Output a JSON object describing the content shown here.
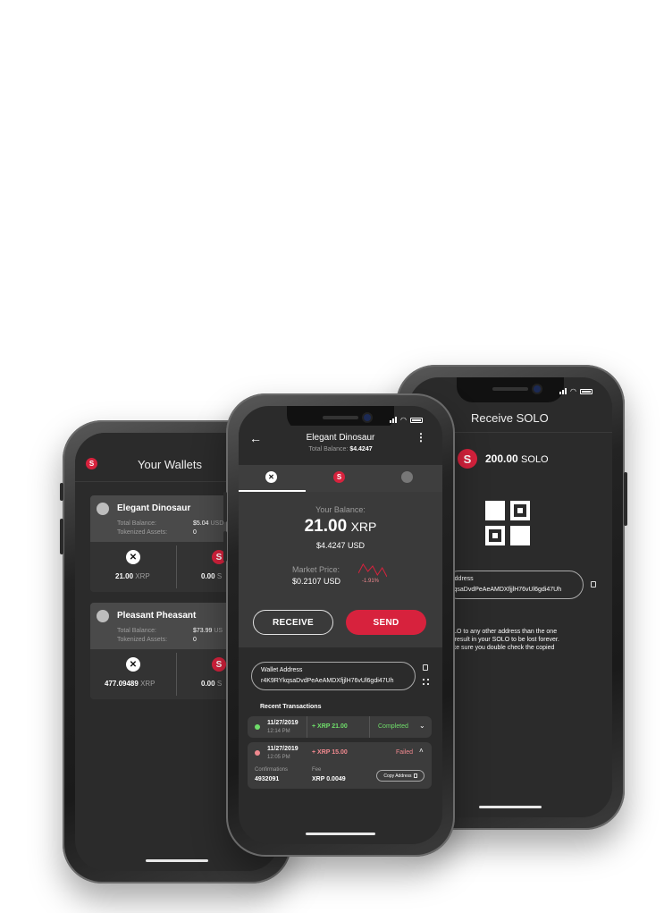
{
  "colors": {
    "accent": "#d7223d",
    "completed": "#6fdd6a",
    "failed": "#f0898f"
  },
  "left_phone": {
    "header_title": "Your Wallets",
    "wallets": [
      {
        "name": "Elegant Dinosaur",
        "balance_label": "Total Balance:",
        "balance_value": "$5.04",
        "balance_unit": "USD",
        "assets_label": "Tokenized Assets:",
        "assets_value": "0",
        "xrp_amount": "21.00",
        "xrp_unit": "XRP",
        "solo_amount": "0.00",
        "solo_unit": "S"
      },
      {
        "name": "Pleasant Pheasant",
        "balance_label": "Total Balance:",
        "balance_value": "$73.99",
        "balance_unit": "US",
        "assets_label": "Tokenized Assets:",
        "assets_value": "0",
        "xrp_amount": "477.09489",
        "xrp_unit": "XRP",
        "solo_amount": "0.00",
        "solo_unit": "S"
      }
    ]
  },
  "center_phone": {
    "back_icon": "arrow-left-icon",
    "title": "Elegant Dinosaur",
    "subtitle_label": "Total Balance:",
    "subtitle_value": "$4.4247",
    "more_icon": "more-vertical-icon",
    "tabs": [
      "xrp",
      "solo",
      "token"
    ],
    "balance_label": "Your Balance:",
    "balance_amount": "21.00",
    "balance_unit": "XRP",
    "balance_usd": "$4.4247 USD",
    "market_label": "Market Price:",
    "market_value": "$0.2107 USD",
    "market_change": "-1.91%",
    "sparkline": [
      3,
      8,
      4,
      7,
      2,
      6,
      1
    ],
    "receive_label": "RECEIVE",
    "send_label": "SEND",
    "wallet_address_label": "Wallet Address",
    "wallet_address": "r4K9RYkqsaDvdPeAeAMDXfjjlH76vUl6gdi47Uh",
    "recent_title": "Recent Transactions",
    "transactions": [
      {
        "date": "11/27/2019",
        "time": "12:14 PM",
        "amount": "+ XRP 21.00",
        "status": "Completed",
        "chevron": "v"
      },
      {
        "date": "11/27/2019",
        "time": "12:05 PM",
        "amount": "+ XRP 15.00",
        "status": "Failed",
        "chevron": "^",
        "conf_label": "Confirmations",
        "conf_value": "4932091",
        "fee_label": "Fee",
        "fee_value": "XRP 0.0049",
        "copy_label": "Copy Address"
      }
    ]
  },
  "right_phone": {
    "header_title": "Receive SOLO",
    "amount": "200.00",
    "unit": "SOLO",
    "address_label": "Address",
    "address_value": "kqsaDvdPeAeAMDXfjjlH76vUl6gdi47Uh",
    "warning_line1": "SOLO to any other address than the one",
    "warning_line2": "will result in your SOLO to be lost forever.",
    "warning_line3": "make sure you double check the copied"
  }
}
